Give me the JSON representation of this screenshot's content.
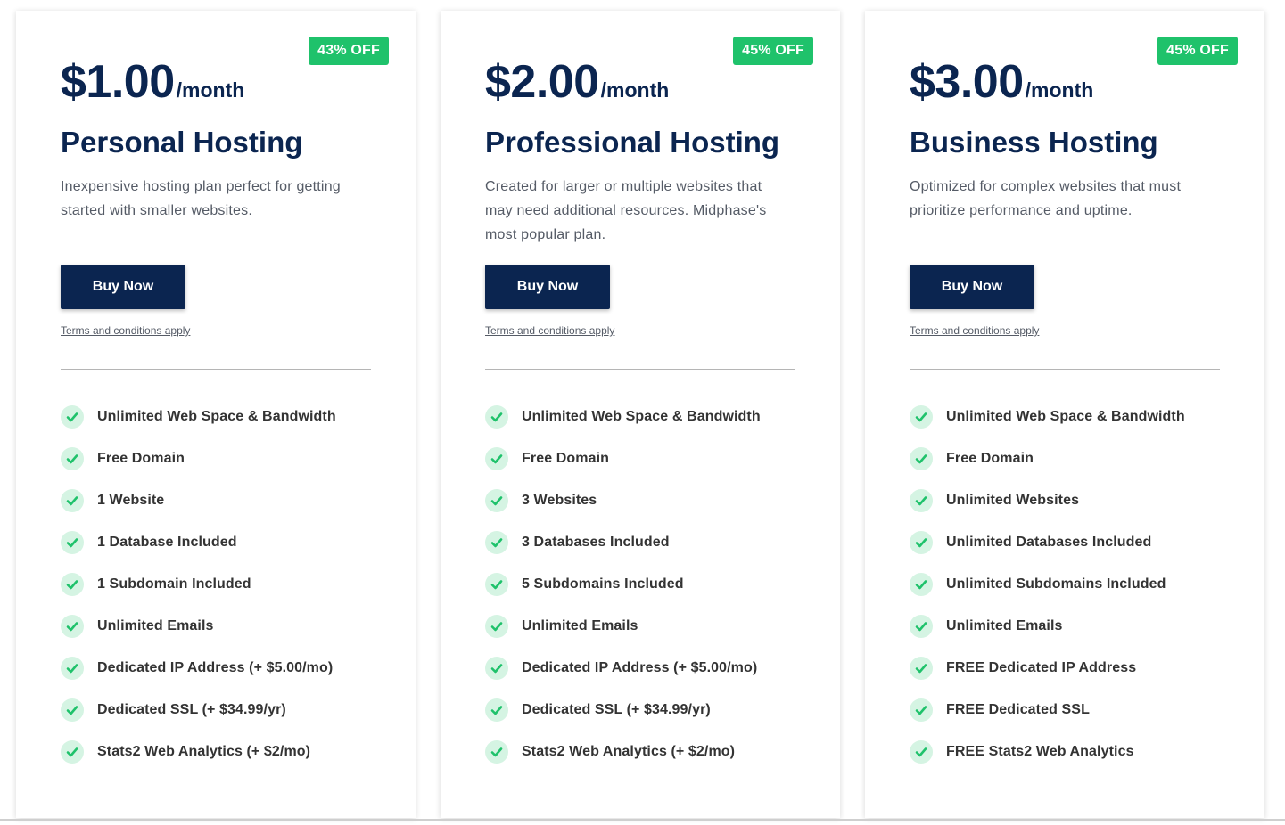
{
  "plans": [
    {
      "badge": "43% OFF",
      "price": "$1.00",
      "period": "/month",
      "name": "Personal Hosting",
      "description": "Inexpensive hosting plan perfect for getting started with smaller websites.",
      "button_label": "Buy Now",
      "terms": "Terms and conditions apply",
      "features": [
        "Unlimited Web Space & Bandwidth",
        "Free Domain",
        "1 Website",
        "1 Database Included",
        "1 Subdomain Included",
        "Unlimited Emails",
        "Dedicated IP Address (+ $5.00/mo)",
        "Dedicated SSL (+ $34.99/yr)",
        "Stats2 Web Analytics (+ $2/mo)"
      ]
    },
    {
      "badge": "45% OFF",
      "price": "$2.00",
      "period": "/month",
      "name": "Professional Hosting",
      "description": "Created for larger or multiple websites that may need additional resources. Midphase's most popular plan.",
      "button_label": "Buy Now",
      "terms": "Terms and conditions apply",
      "features": [
        "Unlimited Web Space & Bandwidth",
        "Free Domain",
        "3 Websites",
        "3 Databases Included",
        "5 Subdomains Included",
        "Unlimited Emails",
        "Dedicated IP Address (+ $5.00/mo)",
        "Dedicated SSL (+ $34.99/yr)",
        "Stats2 Web Analytics (+ $2/mo)"
      ]
    },
    {
      "badge": "45% OFF",
      "price": "$3.00",
      "period": "/month",
      "name": "Business Hosting",
      "description": "Optimized for complex websites that must prioritize performance and uptime.",
      "button_label": "Buy Now",
      "terms": "Terms and conditions apply",
      "features": [
        "Unlimited Web Space & Bandwidth",
        "Free Domain",
        "Unlimited Websites",
        "Unlimited Databases Included",
        "Unlimited Subdomains Included",
        "Unlimited Emails",
        "FREE Dedicated IP Address",
        "FREE Dedicated SSL",
        "FREE Stats2 Web Analytics"
      ]
    }
  ],
  "icons": {
    "feature_check": "check-icon"
  },
  "colors": {
    "navy": "#0b2550",
    "badge_green": "#1fc26b",
    "check_green": "#1fc26b",
    "check_bg": "#d5f4e3"
  }
}
